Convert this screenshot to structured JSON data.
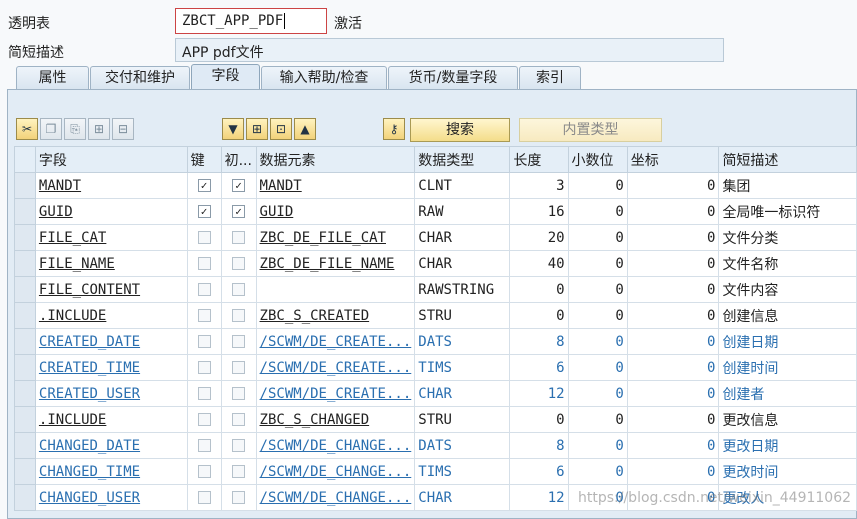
{
  "header": {
    "table_label": "透明表",
    "table_name": "ZBCT_APP_PDF",
    "status": "激活",
    "desc_label": "简短描述",
    "desc_value": "APP pdf文件"
  },
  "tabs": [
    "属性",
    "交付和维护",
    "字段",
    "输入帮助/检查",
    "货币/数量字段",
    "索引"
  ],
  "active_tab": "字段",
  "toolbar": {
    "icons_left": [
      "cut-icon",
      "copy-icon",
      "paste-icon",
      "insert-row-icon",
      "delete-row-icon"
    ],
    "icons_mid": [
      "filter-icon",
      "table-insert-icon",
      "table-delete-icon",
      "upload-icon"
    ],
    "icon_key": "key-icon",
    "search_label": "搜索",
    "builtin_label": "内置类型"
  },
  "columns": [
    "字段",
    "键",
    "初...",
    "数据元素",
    "数据类型",
    "长度",
    "小数位",
    "坐标",
    "简短描述"
  ],
  "rows": [
    {
      "field": "MANDT",
      "key": true,
      "init": true,
      "element": "MANDT",
      "type": "CLNT",
      "length": "3",
      "decimals": "0",
      "coord": "0",
      "desc": "集团",
      "blue": false
    },
    {
      "field": "GUID",
      "key": true,
      "init": true,
      "element": "GUID",
      "type": "RAW",
      "length": "16",
      "decimals": "0",
      "coord": "0",
      "desc": "全局唯一标识符",
      "blue": false
    },
    {
      "field": "FILE_CAT",
      "key": false,
      "init": false,
      "element": "ZBC_DE_FILE_CAT",
      "type": "CHAR",
      "length": "20",
      "decimals": "0",
      "coord": "0",
      "desc": "文件分类",
      "blue": false
    },
    {
      "field": "FILE_NAME",
      "key": false,
      "init": false,
      "element": "ZBC_DE_FILE_NAME",
      "type": "CHAR",
      "length": "40",
      "decimals": "0",
      "coord": "0",
      "desc": "文件名称",
      "blue": false
    },
    {
      "field": "FILE_CONTENT",
      "key": false,
      "init": false,
      "element": "",
      "type": "RAWSTRING",
      "length": "0",
      "decimals": "0",
      "coord": "0",
      "desc": "文件内容",
      "blue": false
    },
    {
      "field": ".INCLUDE",
      "key": false,
      "init": false,
      "element": "ZBC_S_CREATED",
      "type": "STRU",
      "length": "0",
      "decimals": "0",
      "coord": "0",
      "desc": "创建信息",
      "blue": false
    },
    {
      "field": "CREATED_DATE",
      "key": false,
      "init": false,
      "element": "/SCWM/DE_CREATE...",
      "type": "DATS",
      "length": "8",
      "decimals": "0",
      "coord": "0",
      "desc": "创建日期",
      "blue": true
    },
    {
      "field": "CREATED_TIME",
      "key": false,
      "init": false,
      "element": "/SCWM/DE_CREATE...",
      "type": "TIMS",
      "length": "6",
      "decimals": "0",
      "coord": "0",
      "desc": "创建时间",
      "blue": true
    },
    {
      "field": "CREATED_USER",
      "key": false,
      "init": false,
      "element": "/SCWM/DE_CREATE...",
      "type": "CHAR",
      "length": "12",
      "decimals": "0",
      "coord": "0",
      "desc": "创建者",
      "blue": true
    },
    {
      "field": ".INCLUDE",
      "key": false,
      "init": false,
      "element": "ZBC_S_CHANGED",
      "type": "STRU",
      "length": "0",
      "decimals": "0",
      "coord": "0",
      "desc": "更改信息",
      "blue": false
    },
    {
      "field": "CHANGED_DATE",
      "key": false,
      "init": false,
      "element": "/SCWM/DE_CHANGE...",
      "type": "DATS",
      "length": "8",
      "decimals": "0",
      "coord": "0",
      "desc": "更改日期",
      "blue": true
    },
    {
      "field": "CHANGED_TIME",
      "key": false,
      "init": false,
      "element": "/SCWM/DE_CHANGE...",
      "type": "TIMS",
      "length": "6",
      "decimals": "0",
      "coord": "0",
      "desc": "更改时间",
      "blue": true
    },
    {
      "field": "CHANGED_USER",
      "key": false,
      "init": false,
      "element": "/SCWM/DE_CHANGE...",
      "type": "CHAR",
      "length": "12",
      "decimals": "0",
      "coord": "0",
      "desc": "更改人",
      "blue": true
    }
  ],
  "watermark": "https://blog.csdn.net/weixin_44911062",
  "colors": {
    "link_blue": "#2a6fb0",
    "panel_bg": "#e2ecf5",
    "input_border_active": "#cc4444"
  }
}
